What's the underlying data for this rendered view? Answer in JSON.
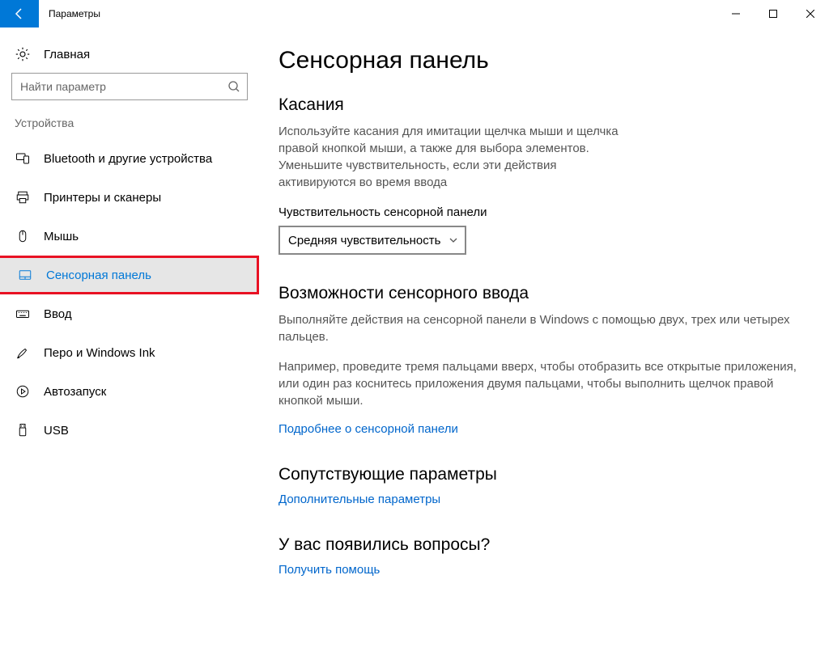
{
  "window": {
    "title": "Параметры"
  },
  "sidebar": {
    "home": "Главная",
    "search_placeholder": "Найти параметр",
    "category": "Устройства",
    "items": [
      {
        "label": "Bluetooth и другие устройства"
      },
      {
        "label": "Принтеры и сканеры"
      },
      {
        "label": "Мышь"
      },
      {
        "label": "Сенсорная панель"
      },
      {
        "label": "Ввод"
      },
      {
        "label": "Перо и Windows Ink"
      },
      {
        "label": "Автозапуск"
      },
      {
        "label": "USB"
      }
    ]
  },
  "main": {
    "title": "Сенсорная панель",
    "taps": {
      "heading": "Касания",
      "body": "Используйте касания для имитации щелчка мыши и щелчка правой кнопкой мыши, а также для выбора элементов. Уменьшите чувствительность, если эти действия активируются во время ввода",
      "sensitivity_label": "Чувствительность сенсорной панели",
      "sensitivity_value": "Средняя чувствительность"
    },
    "gestures": {
      "heading": "Возможности сенсорного ввода",
      "body1": "Выполняйте действия на сенсорной панели в Windows с помощью двух, трех или четырех пальцев.",
      "body2": "Например, проведите тремя пальцами вверх, чтобы отобразить все открытые приложения, или один раз коснитесь приложения двумя пальцами, чтобы выполнить щелчок правой кнопкой мыши.",
      "link": "Подробнее о сенсорной панели"
    },
    "related": {
      "heading": "Сопутствующие параметры",
      "link": "Дополнительные параметры"
    },
    "help": {
      "heading": "У вас появились вопросы?",
      "link": "Получить помощь"
    }
  }
}
